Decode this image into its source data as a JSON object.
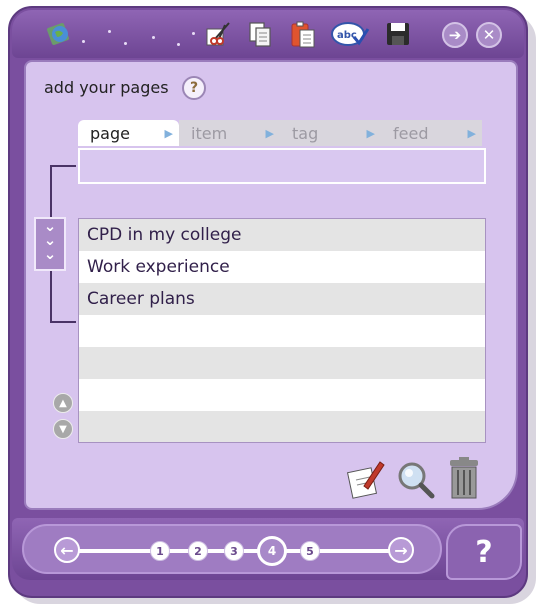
{
  "heading": "add your pages",
  "help_glyph": "?",
  "tabs": [
    {
      "label": "page",
      "active": true
    },
    {
      "label": "item",
      "active": false
    },
    {
      "label": "tag",
      "active": false
    },
    {
      "label": "feed",
      "active": false
    }
  ],
  "title_input_value": "",
  "list_items": [
    "CPD in my college",
    "Work experience",
    "Career plans",
    "",
    "",
    "",
    ""
  ],
  "pagination": {
    "pages": [
      "1",
      "2",
      "3",
      "4",
      "5"
    ],
    "current": "4"
  },
  "bottom_help_label": "?",
  "toolbar_icons": [
    "globe-icon",
    "cut-icon",
    "copy-icon",
    "paste-icon",
    "spellcheck-icon",
    "save-icon",
    "forward-icon",
    "close-icon"
  ],
  "spellcheck_text": "abc",
  "colors": {
    "frame": "#7a4f9f",
    "panel": "#d7c4ee",
    "accent": "#a98bc7",
    "list_text": "#31204a"
  }
}
